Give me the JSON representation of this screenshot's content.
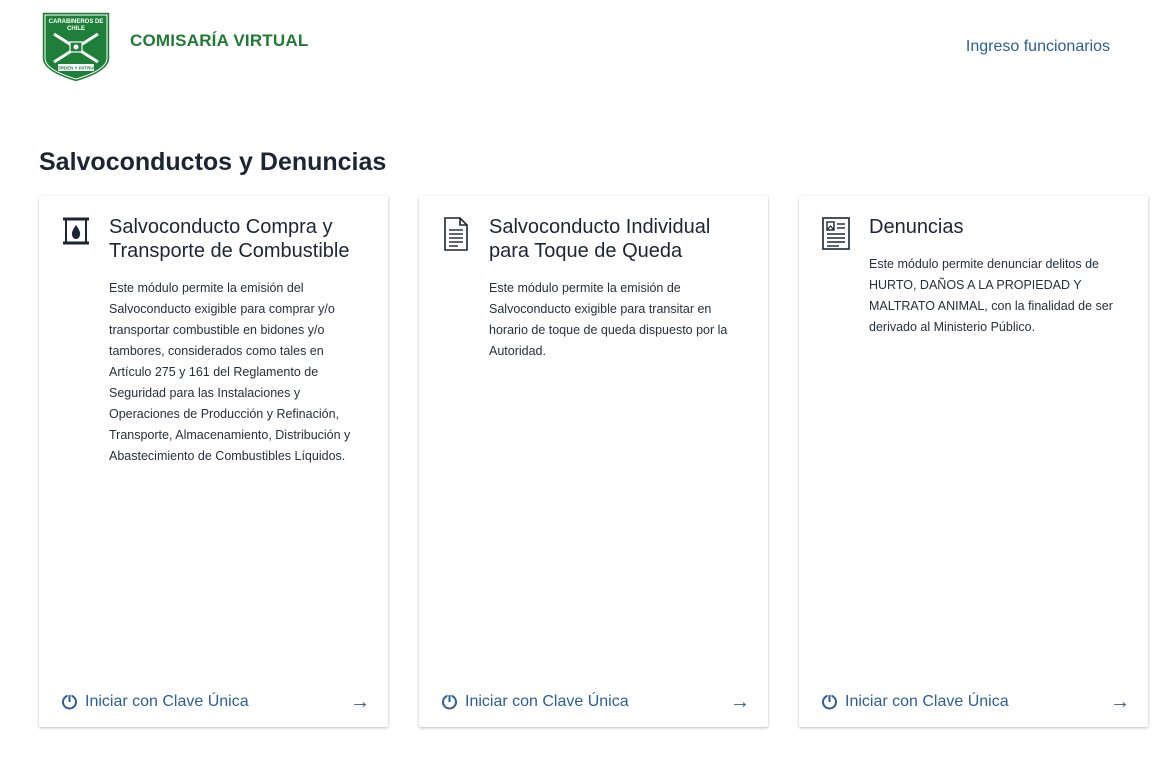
{
  "header": {
    "logo_text_top": "CARABINEROS DE CHILE",
    "logo_text_bottom": "ORDEN Y PATRIA",
    "brand": "COMISARÍA VIRTUAL",
    "login_link": "Ingreso funcionarios"
  },
  "page": {
    "title": "Salvoconductos y Denuncias"
  },
  "colors": {
    "brand_green": "#1f7a34",
    "link_blue": "#2a5e9a",
    "text_dark": "#1c2535"
  },
  "cards": [
    {
      "icon": "fuel-drum-icon",
      "title": "Salvoconducto Compra y Transporte de Combustible",
      "description": "Este módulo permite la emisión del Salvoconducto exigible para comprar y/o transportar combustible en bidones y/o tambores, considerados como tales en Artículo 275 y 161 del Reglamento de Seguridad para las Instalaciones y Operaciones de Producción y Refinación, Transporte, Almacenamiento, Distribución y Abastecimiento de Combustibles Líquidos.",
      "action_label": "Iniciar con Clave Única",
      "action_icon": "power-icon",
      "arrow_icon": "arrow-right-icon"
    },
    {
      "icon": "document-icon",
      "title": "Salvoconducto Individual para Toque de Queda",
      "description": "Este módulo permite la emisión de Salvoconducto exigible para transitar en horario de toque de queda dispuesto por la Autoridad.",
      "action_label": "Iniciar con Clave Única",
      "action_icon": "power-icon",
      "arrow_icon": "arrow-right-icon"
    },
    {
      "icon": "report-document-icon",
      "title": "Denuncias",
      "description": "Este módulo permite denunciar delitos de HURTO, DAÑOS A LA PROPIEDAD Y MALTRATO ANIMAL, con la finalidad de ser derivado al Ministerio Público.",
      "action_label": "Iniciar con Clave Única",
      "action_icon": "power-icon",
      "arrow_icon": "arrow-right-icon"
    }
  ]
}
